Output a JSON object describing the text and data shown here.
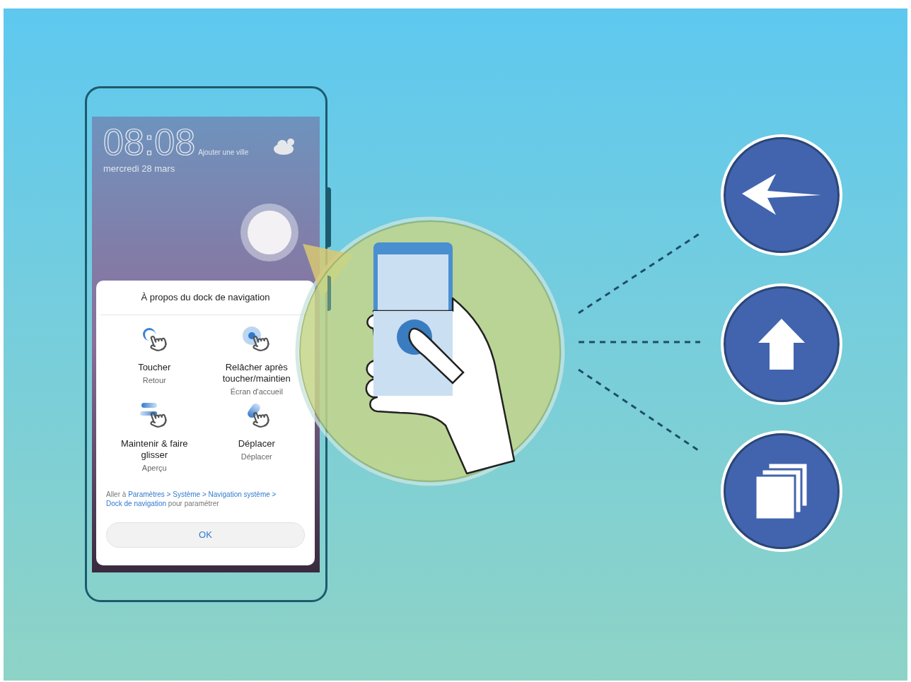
{
  "phone": {
    "clock": "08:08",
    "city_hint": "Ajouter une ville",
    "date": "mercredi 28 mars"
  },
  "dialog": {
    "title": "À propos du dock de navigation",
    "gestures": [
      {
        "kind": "tap",
        "title": "Toucher",
        "action": "Retour"
      },
      {
        "kind": "hold",
        "title": "Relâcher après toucher/maintien",
        "action": "Écran d'accueil"
      },
      {
        "kind": "slide",
        "title": "Maintenir & faire glisser",
        "action": "Aperçu"
      },
      {
        "kind": "drag",
        "title": "Déplacer",
        "action": "Déplacer"
      }
    ],
    "hint": [
      {
        "kind": "text",
        "text": "Aller à"
      },
      {
        "kind": "link",
        "text": "Paramètres > Système > Navigation système >"
      },
      {
        "kind": "link",
        "text": "Dock de navigation"
      },
      {
        "kind": "text",
        "text": "pour paramétrer"
      }
    ],
    "button": "OK"
  },
  "actions": [
    {
      "kind": "back"
    },
    {
      "kind": "home"
    },
    {
      "kind": "recents"
    }
  ]
}
